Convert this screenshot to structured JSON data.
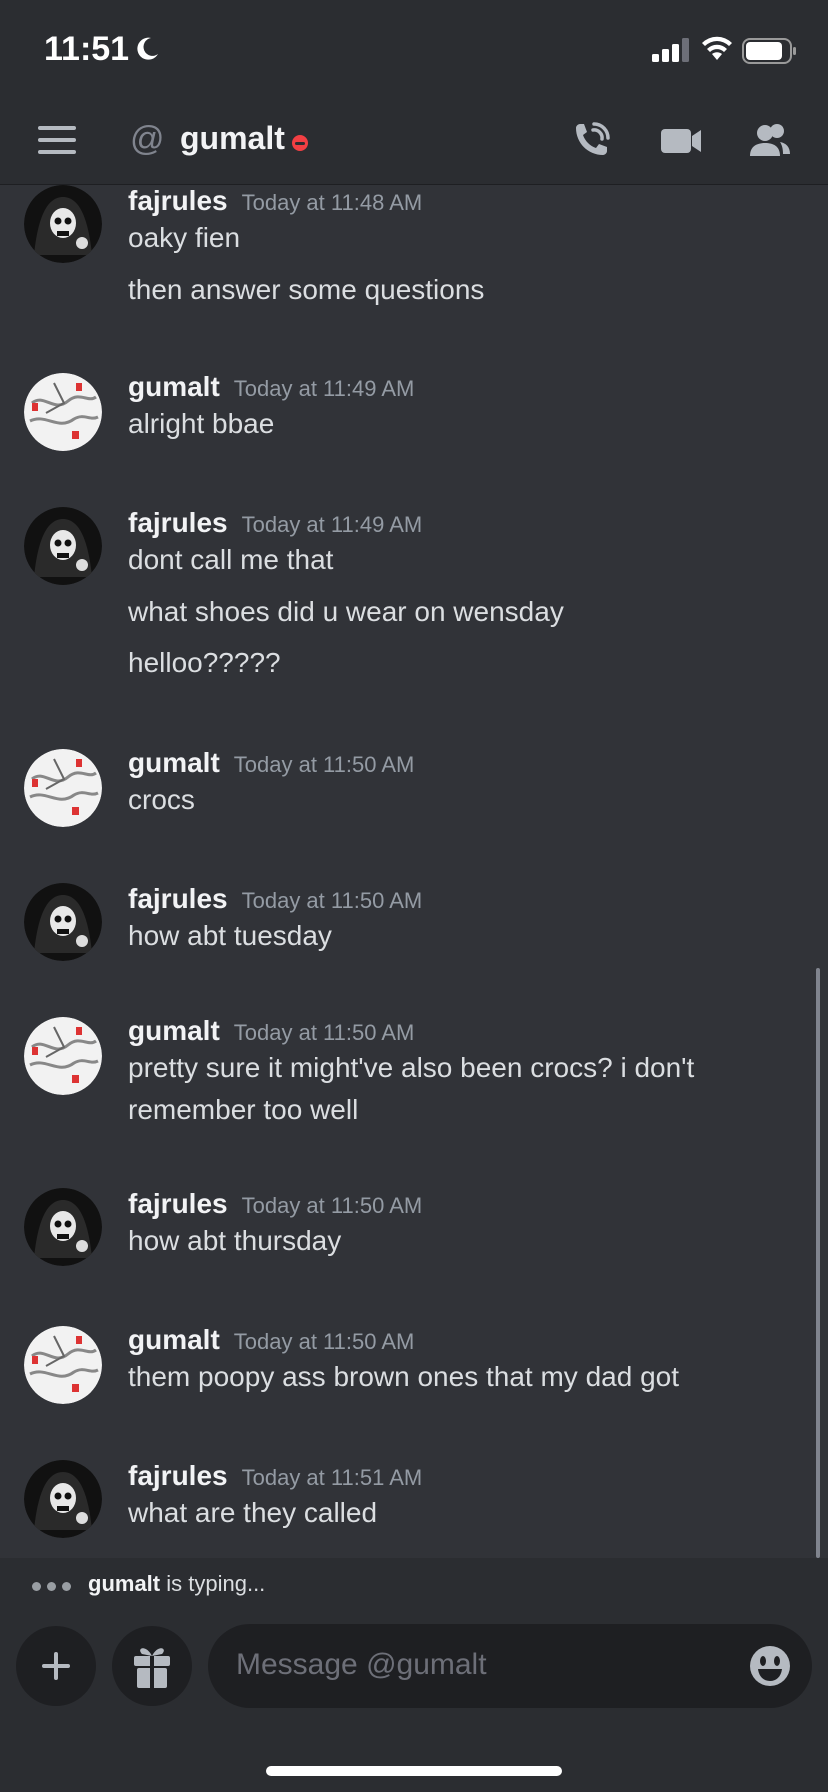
{
  "status_bar": {
    "time": "11:51"
  },
  "header": {
    "channel_name": "gumalt"
  },
  "messages": [
    {
      "author": "fajrules",
      "timestamp": "Today at 11:48 AM",
      "lines": [
        "oaky fien",
        "then answer some questions"
      ]
    },
    {
      "author": "gumalt",
      "timestamp": "Today at 11:49 AM",
      "lines": [
        "alright bbae"
      ]
    },
    {
      "author": "fajrules",
      "timestamp": "Today at 11:49 AM",
      "lines": [
        "dont call me that",
        "what shoes did u wear on wensday",
        "helloo?????"
      ]
    },
    {
      "author": "gumalt",
      "timestamp": "Today at 11:50 AM",
      "lines": [
        "crocs"
      ]
    },
    {
      "author": "fajrules",
      "timestamp": "Today at 11:50 AM",
      "lines": [
        "how abt tuesday"
      ]
    },
    {
      "author": "gumalt",
      "timestamp": "Today at 11:50 AM",
      "lines": [
        "pretty sure it might've also been crocs? i don't",
        "remember too well"
      ]
    },
    {
      "author": "fajrules",
      "timestamp": "Today at 11:50 AM",
      "lines": [
        "how abt thursday"
      ]
    },
    {
      "author": "gumalt",
      "timestamp": "Today at 11:50 AM",
      "lines": [
        "them poopy ass brown ones that my dad got"
      ]
    },
    {
      "author": "fajrules",
      "timestamp": "Today at 11:51 AM",
      "lines": [
        "what are they called"
      ]
    }
  ],
  "typing": {
    "user": "gumalt",
    "suffix": "is typing..."
  },
  "composer": {
    "placeholder": "Message @gumalt"
  },
  "icons": {
    "menu": "hamburger-icon",
    "mention": "at-icon",
    "status": "dnd-status-icon",
    "call": "phone-call-icon",
    "video": "video-camera-icon",
    "members": "members-icon",
    "add": "plus-icon",
    "gift": "gift-icon",
    "emoji": "emoji-icon"
  },
  "colors": {
    "background": "#313338",
    "header": "#2b2d31",
    "dnd": "#f23f43",
    "input": "#1e1f22"
  }
}
